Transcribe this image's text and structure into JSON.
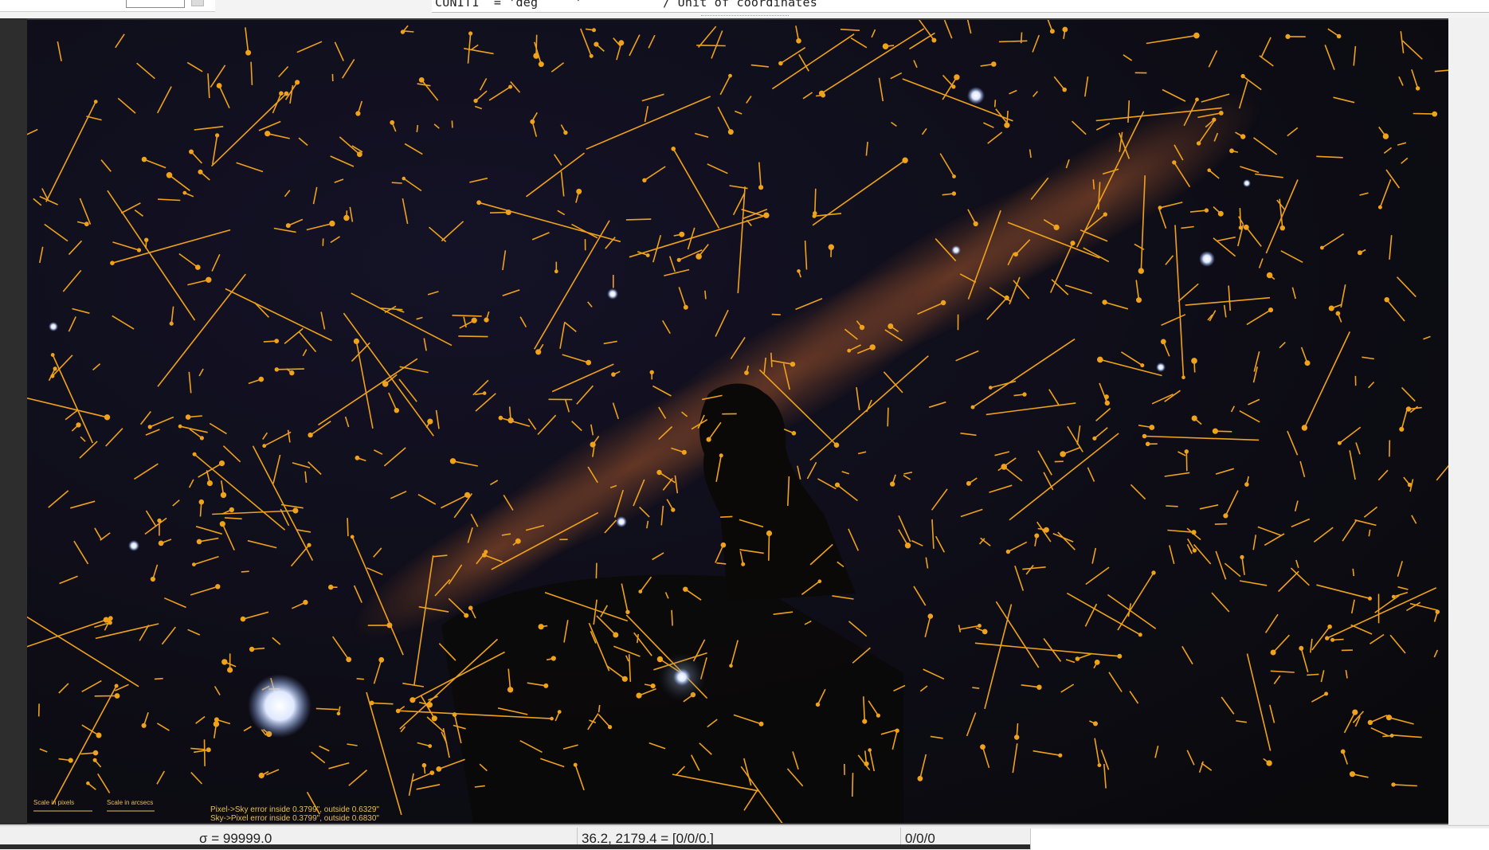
{
  "top_bar": {
    "fits_header_line": "CUNIT1  = 'deg     '           / Unit of coordinates"
  },
  "sky_image": {
    "description_label": "Horsehead nebula field with plate-solve residual vectors"
  },
  "overlay": {
    "scale_pixels_label": "Scale in pixels",
    "scale_arcsec_label": "Scale in arcsecs",
    "error_line_1": "Pixel->Sky error inside 0.3799\", outside 0.6329\"",
    "error_line_2": "Sky->Pixel error inside 0.3799\", outside 0.6830\""
  },
  "status_bar": {
    "sigma": "σ = 99999.0",
    "coords": "36.2, 2179.4 = [0/0/0.]",
    "values": "0/0/0"
  },
  "colors": {
    "vector": "#f0a21a",
    "background_sky": "#0d0c12",
    "nebula": "#8a4a2a"
  }
}
